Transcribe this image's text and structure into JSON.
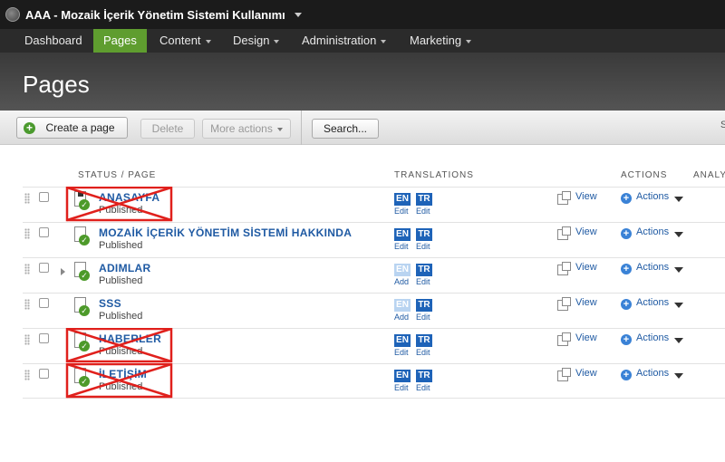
{
  "topbar": {
    "site_title": "AAA - Mozaik İçerik Yönetim Sistemi Kullanımı"
  },
  "nav": {
    "items": [
      {
        "label": "Dashboard",
        "active": false,
        "dropdown": false
      },
      {
        "label": "Pages",
        "active": true,
        "dropdown": false
      },
      {
        "label": "Content",
        "active": false,
        "dropdown": true
      },
      {
        "label": "Design",
        "active": false,
        "dropdown": true
      },
      {
        "label": "Administration",
        "active": false,
        "dropdown": true
      },
      {
        "label": "Marketing",
        "active": false,
        "dropdown": true
      }
    ]
  },
  "header": {
    "title": "Pages"
  },
  "toolbar": {
    "create_label": "Create a page",
    "delete_label": "Delete",
    "more_actions_label": "More actions",
    "search_label": "Search...",
    "right_cut": "S"
  },
  "table": {
    "headers": {
      "status": "STATUS / PAGE",
      "translations": "TRANSLATIONS",
      "actions": "ACTIONS",
      "analytics": "ANALYT"
    },
    "view_label": "View",
    "actions_label": "Actions",
    "rows": [
      {
        "name": "ANASAYFA",
        "status": "Published",
        "expandable": false,
        "home": true,
        "crossed": true,
        "langs": [
          {
            "code": "EN",
            "action": "Edit",
            "exists": true
          },
          {
            "code": "TR",
            "action": "Edit",
            "exists": true
          }
        ]
      },
      {
        "name": "MOZAİK İÇERİK YÖNETİM SİSTEMİ HAKKINDA",
        "status": "Published",
        "expandable": false,
        "home": false,
        "crossed": false,
        "langs": [
          {
            "code": "EN",
            "action": "Edit",
            "exists": true
          },
          {
            "code": "TR",
            "action": "Edit",
            "exists": true
          }
        ]
      },
      {
        "name": "ADIMLAR",
        "status": "Published",
        "expandable": true,
        "home": false,
        "crossed": false,
        "langs": [
          {
            "code": "EN",
            "action": "Add",
            "exists": false
          },
          {
            "code": "TR",
            "action": "Edit",
            "exists": true
          }
        ]
      },
      {
        "name": "SSS",
        "status": "Published",
        "expandable": false,
        "home": false,
        "crossed": false,
        "langs": [
          {
            "code": "EN",
            "action": "Add",
            "exists": false
          },
          {
            "code": "TR",
            "action": "Edit",
            "exists": true
          }
        ]
      },
      {
        "name": "HABERLER",
        "status": "Published",
        "expandable": false,
        "home": false,
        "crossed": true,
        "langs": [
          {
            "code": "EN",
            "action": "Edit",
            "exists": true
          },
          {
            "code": "TR",
            "action": "Edit",
            "exists": true
          }
        ]
      },
      {
        "name": "İLETİŞİM",
        "status": "Published",
        "expandable": false,
        "home": false,
        "crossed": true,
        "langs": [
          {
            "code": "EN",
            "action": "Edit",
            "exists": true
          },
          {
            "code": "TR",
            "action": "Edit",
            "exists": true
          }
        ]
      }
    ]
  },
  "colors": {
    "nav_active": "#5f9d2f",
    "link": "#1f5aa3",
    "lang_badge": "#1e63b8",
    "lang_badge_missing": "#b9d4f1",
    "annotation_x": "#e0201c"
  }
}
